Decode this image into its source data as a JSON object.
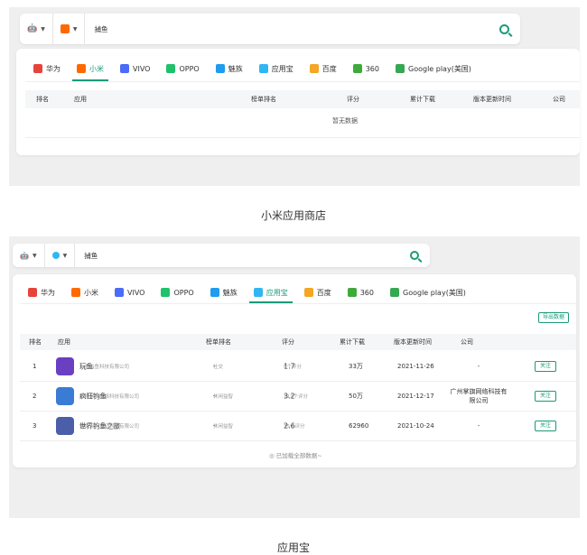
{
  "screen1": {
    "search": {
      "query": "捕鱼"
    },
    "tabs": [
      {
        "label": "华为",
        "color": "#e8433a"
      },
      {
        "label": "小米",
        "color": "#ff6900",
        "active": true
      },
      {
        "label": "VIVO",
        "color": "#4a6cf7"
      },
      {
        "label": "OPPO",
        "color": "#1fc26b"
      },
      {
        "label": "魅族",
        "color": "#1e9cf0"
      },
      {
        "label": "应用宝",
        "color": "#30b7f2"
      },
      {
        "label": "百度",
        "color": "#f5a623"
      },
      {
        "label": "360",
        "color": "#3eaa3a"
      },
      {
        "label": "Google play(美国)",
        "color": "#34a853"
      }
    ],
    "columns": [
      "排名",
      "应用",
      "榜单排名",
      "评分",
      "累计下载",
      "版本更新时间",
      "公司"
    ],
    "empty_text": "暂无数据"
  },
  "caption1": "小米应用商店",
  "screen2": {
    "search": {
      "query": "捕鱼"
    },
    "tabs": [
      {
        "label": "华为",
        "color": "#e8433a"
      },
      {
        "label": "小米",
        "color": "#ff6900"
      },
      {
        "label": "VIVO",
        "color": "#4a6cf7"
      },
      {
        "label": "OPPO",
        "color": "#1fc26b"
      },
      {
        "label": "魅族",
        "color": "#1e9cf0"
      },
      {
        "label": "应用宝",
        "color": "#30b7f2",
        "active": true
      },
      {
        "label": "百度",
        "color": "#f5a623"
      },
      {
        "label": "360",
        "color": "#3eaa3a"
      },
      {
        "label": "Google play(美国)",
        "color": "#34a853"
      }
    ],
    "export_label": "导出数据",
    "columns": [
      "排名",
      "应用",
      "榜单排名",
      "评分",
      "累计下载",
      "版本更新时间",
      "公司"
    ],
    "rows": [
      {
        "rank": "1",
        "name": "玩鱼",
        "company_sub": "上海指鱼科技有限公司",
        "list_rank": "-",
        "list_sub": "社交",
        "score": "1.7",
        "score_sub": "6个评分",
        "downloads": "33万",
        "updated": "2021-11-26",
        "company": "-",
        "follow": "关注",
        "icon_color": "#6a3fc1"
      },
      {
        "rank": "2",
        "name": "疯狂钓鱼",
        "company_sub": "广州掌旗网络科技有限公司",
        "list_rank": "-",
        "list_sub": "休闲益智",
        "score": "3.2",
        "score_sub": "112个评分",
        "downloads": "50万",
        "updated": "2021-12-17",
        "company": "广州掌旗网络科技有限公司",
        "follow": "关注",
        "icon_color": "#3a7bd5"
      },
      {
        "rank": "3",
        "name": "世界钓鱼之旅",
        "company_sub": "海南点点互动科技有限公司",
        "list_rank": "-",
        "list_sub": "休闲益智",
        "score": "2.6",
        "score_sub": "35个评分",
        "downloads": "62960",
        "updated": "2021-10-24",
        "company": "-",
        "follow": "关注",
        "icon_color": "#4a5fa8"
      }
    ],
    "loaded_text": "◎ 已加载全部数据~"
  },
  "caption2": "应用宝"
}
